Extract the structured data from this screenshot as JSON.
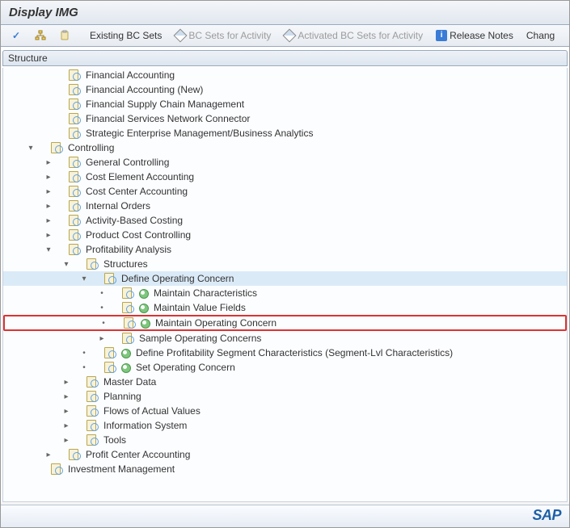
{
  "header": {
    "title": "Display IMG"
  },
  "toolbar": {
    "existing_bc_sets": "Existing BC Sets",
    "bc_sets_for_activity": "BC Sets for Activity",
    "activated_bc_sets_for_activity": "Activated BC Sets for Activity",
    "release_notes": "Release Notes",
    "change_log": "Chang"
  },
  "tree": {
    "header": "Structure",
    "nodes": [
      {
        "indent": 1,
        "toggle": "none",
        "icons": [
          "doc"
        ],
        "label": "Financial Accounting",
        "interact": true
      },
      {
        "indent": 1,
        "toggle": "none",
        "icons": [
          "doc"
        ],
        "label": "Financial Accounting (New)",
        "interact": true
      },
      {
        "indent": 1,
        "toggle": "none",
        "icons": [
          "doc"
        ],
        "label": "Financial Supply Chain Management",
        "interact": true
      },
      {
        "indent": 1,
        "toggle": "none",
        "icons": [
          "doc"
        ],
        "label": "Financial Services Network Connector",
        "interact": true
      },
      {
        "indent": 1,
        "toggle": "none",
        "icons": [
          "doc"
        ],
        "label": "Strategic Enterprise Management/Business Analytics",
        "interact": true
      },
      {
        "indent": 0,
        "toggle": "col",
        "icons": [
          "doc"
        ],
        "label": "Controlling",
        "interact": true
      },
      {
        "indent": 1,
        "toggle": "exp",
        "icons": [
          "doc"
        ],
        "label": "General Controlling",
        "interact": true
      },
      {
        "indent": 1,
        "toggle": "exp",
        "icons": [
          "doc"
        ],
        "label": "Cost Element Accounting",
        "interact": true
      },
      {
        "indent": 1,
        "toggle": "exp",
        "icons": [
          "doc"
        ],
        "label": "Cost Center Accounting",
        "interact": true
      },
      {
        "indent": 1,
        "toggle": "exp",
        "icons": [
          "doc"
        ],
        "label": "Internal Orders",
        "interact": true
      },
      {
        "indent": 1,
        "toggle": "exp",
        "icons": [
          "doc"
        ],
        "label": "Activity-Based Costing",
        "interact": true
      },
      {
        "indent": 1,
        "toggle": "exp",
        "icons": [
          "doc"
        ],
        "label": "Product Cost Controlling",
        "interact": true
      },
      {
        "indent": 1,
        "toggle": "col",
        "icons": [
          "doc"
        ],
        "label": "Profitability Analysis",
        "interact": true
      },
      {
        "indent": 2,
        "toggle": "col",
        "icons": [
          "doc"
        ],
        "label": "Structures",
        "interact": true
      },
      {
        "indent": 3,
        "toggle": "col",
        "icons": [
          "doc"
        ],
        "label": "Define Operating Concern",
        "interact": true,
        "selected": true
      },
      {
        "indent": 4,
        "toggle": "dot",
        "icons": [
          "doc",
          "exec"
        ],
        "label": "Maintain Characteristics",
        "interact": true
      },
      {
        "indent": 4,
        "toggle": "dot",
        "icons": [
          "doc",
          "exec"
        ],
        "label": "Maintain Value Fields",
        "interact": true
      },
      {
        "indent": 4,
        "toggle": "dot",
        "icons": [
          "doc",
          "exec"
        ],
        "label": "Maintain Operating Concern",
        "interact": true,
        "highlight": true
      },
      {
        "indent": 4,
        "toggle": "exp",
        "icons": [
          "doc"
        ],
        "label": "Sample Operating Concerns",
        "interact": true
      },
      {
        "indent": 3,
        "toggle": "dot",
        "icons": [
          "doc",
          "exec"
        ],
        "label": "Define Profitability Segment Characteristics (Segment-Lvl Characteristics)",
        "interact": true
      },
      {
        "indent": 3,
        "toggle": "dot",
        "icons": [
          "doc",
          "exec"
        ],
        "label": "Set Operating Concern",
        "interact": true
      },
      {
        "indent": 2,
        "toggle": "exp",
        "icons": [
          "doc"
        ],
        "label": "Master Data",
        "interact": true
      },
      {
        "indent": 2,
        "toggle": "exp",
        "icons": [
          "doc"
        ],
        "label": "Planning",
        "interact": true
      },
      {
        "indent": 2,
        "toggle": "exp",
        "icons": [
          "doc"
        ],
        "label": "Flows of Actual Values",
        "interact": true
      },
      {
        "indent": 2,
        "toggle": "exp",
        "icons": [
          "doc"
        ],
        "label": "Information System",
        "interact": true
      },
      {
        "indent": 2,
        "toggle": "exp",
        "icons": [
          "doc"
        ],
        "label": "Tools",
        "interact": true
      },
      {
        "indent": 1,
        "toggle": "exp",
        "icons": [
          "doc"
        ],
        "label": "Profit Center Accounting",
        "interact": true
      },
      {
        "indent": 0,
        "toggle": "none",
        "icons": [
          "doc"
        ],
        "label": "Investment Management",
        "interact": true
      }
    ]
  },
  "logo": "SAP"
}
